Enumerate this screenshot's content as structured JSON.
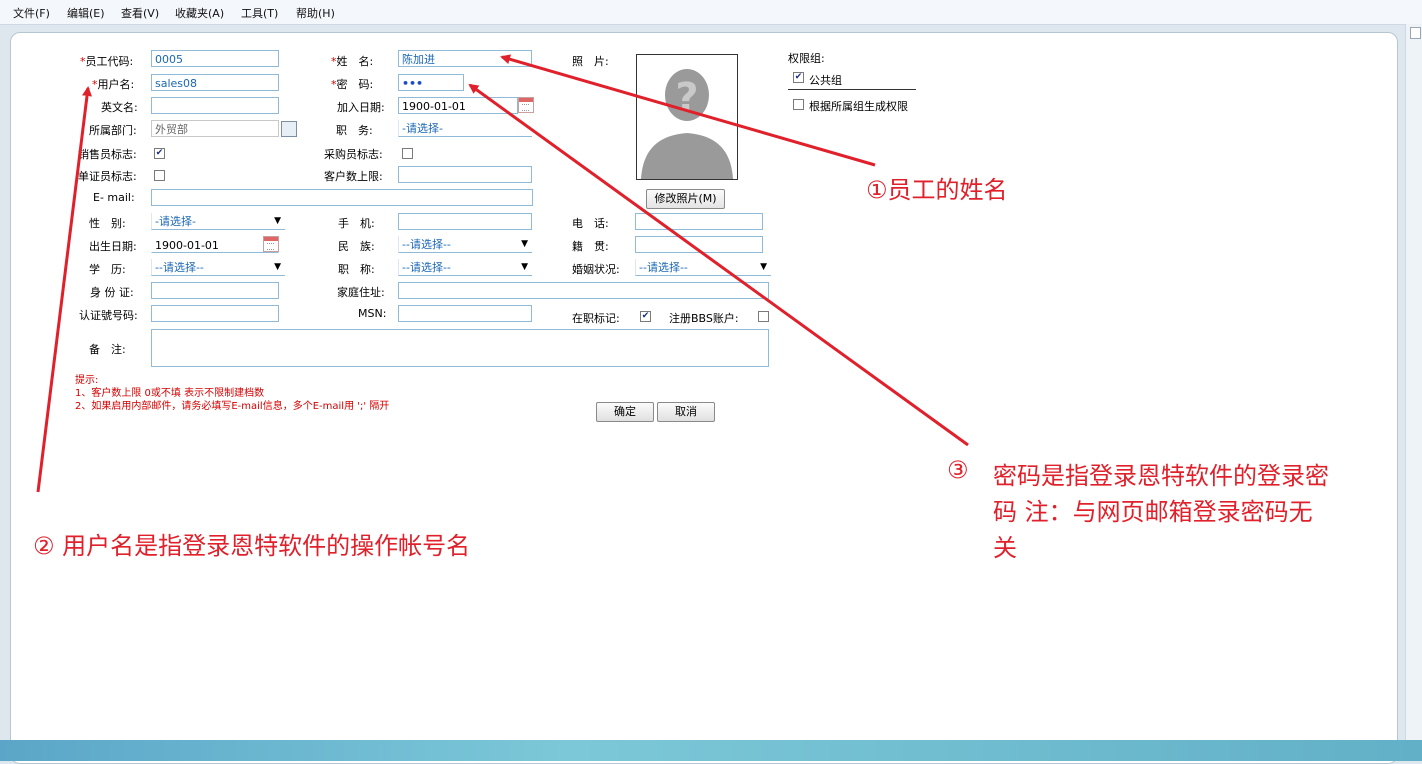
{
  "menu": [
    "文件(F)",
    "编辑(E)",
    "查看(V)",
    "收藏夹(A)",
    "工具(T)",
    "帮助(H)"
  ],
  "labels": {
    "emp_code": "员工代码:",
    "username": "用户名:",
    "english_name": "英文名:",
    "department": "所属部门:",
    "sales_flag": "销售员标志:",
    "doc_flag": "单证员标志:",
    "email": "E- mail:",
    "gender": "性　别:",
    "birthdate": "出生日期:",
    "education": "学　历:",
    "id_card": "身 份 证:",
    "cert_no": "认证號号码:",
    "remark": "备　注:",
    "name": "姓　名:",
    "password": "密　码:",
    "join_date": "加入日期:",
    "position": "职　务:",
    "purchase_flag": "采购员标志:",
    "customer_limit": "客户数上限:",
    "mobile": "手　机:",
    "ethnicity": "民　族:",
    "title": "职　称:",
    "address": "家庭住址:",
    "msn": "MSN:",
    "photo": "照　片:",
    "phone": "电　话:",
    "native_place": "籍　贯:",
    "marital": "婚姻状况:",
    "employed": "在职标记:",
    "bbs": "注册BBS账户:",
    "permission_group": "权限组:",
    "public_group": "公共组",
    "generate_perm": "根据所属组生成权限"
  },
  "values": {
    "emp_code": "0005",
    "username": "sales08",
    "english_name": "",
    "department": "外贸部",
    "name": "陈加进",
    "password": "•••",
    "join_date": "1900-01-01",
    "position": "-请选择-",
    "gender": "-请选择-",
    "birthdate": "1900-01-01",
    "ethnicity": "--请选择--",
    "education": "--请选择--",
    "title": "--请选择--",
    "marital": "--请选择--"
  },
  "checks": {
    "sales_flag": true,
    "doc_flag": false,
    "purchase_flag": false,
    "employed": true,
    "bbs": false,
    "public_group": true,
    "generate_perm": false
  },
  "buttons": {
    "change_photo": "修改照片(M)",
    "confirm": "确定",
    "cancel": "取消"
  },
  "tips": {
    "title": "提示:",
    "line1": "1、客户数上限  0或不填  表示不限制建档数",
    "line2": "2、如果启用内部邮件，请务必填写E-mail信息，多个E-mail用  ';'  隔开"
  },
  "annotations": {
    "a1_num": "①",
    "a1_text": "员工的姓名",
    "a2_num": "②",
    "a2_text": "用户名是指登录恩特软件的操作帐号名",
    "a3_num": "③",
    "a3_line1": "密码是指登录恩特软件的登录密",
    "a3_line2": "码 注：与网页邮箱登录密码无",
    "a3_line3": "关"
  },
  "colors": {
    "annotation": "#e0202a",
    "input_border": "#8fbbd9",
    "required": "#d40000"
  }
}
